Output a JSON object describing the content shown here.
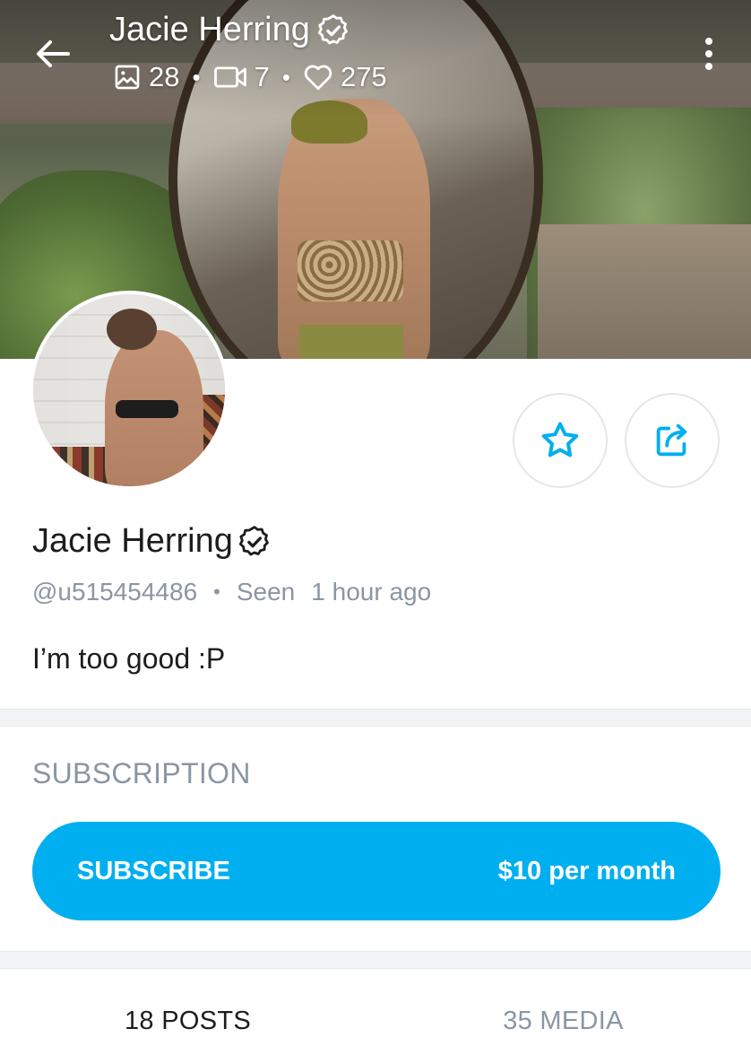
{
  "header": {
    "title": "Jacie Herring",
    "stats": {
      "photos": "28",
      "videos": "7",
      "likes": "275"
    },
    "separator": "•"
  },
  "icons": {
    "back": "arrow-left-icon",
    "verified": "verified-badge-icon",
    "photo": "image-icon",
    "video": "video-icon",
    "likes": "heart-icon",
    "more": "more-vertical-icon",
    "favorite": "star-icon",
    "share": "share-icon"
  },
  "profile": {
    "name": "Jacie Herring",
    "username": "@u515454486",
    "seen_label": "Seen",
    "seen_time": "1 hour ago",
    "separator": "•",
    "bio": "I’m too good :P"
  },
  "subscription": {
    "section_title": "SUBSCRIPTION",
    "button_label": "SUBSCRIBE",
    "price": "$10 per month"
  },
  "tabs": [
    {
      "label": "18 POSTS",
      "active": true
    },
    {
      "label": "35 MEDIA",
      "active": false
    }
  ],
  "colors": {
    "accent": "#00aff0",
    "muted_text": "#8a96a3",
    "primary_text": "#1d1d1f",
    "separator_bg": "#f2f3f5"
  }
}
